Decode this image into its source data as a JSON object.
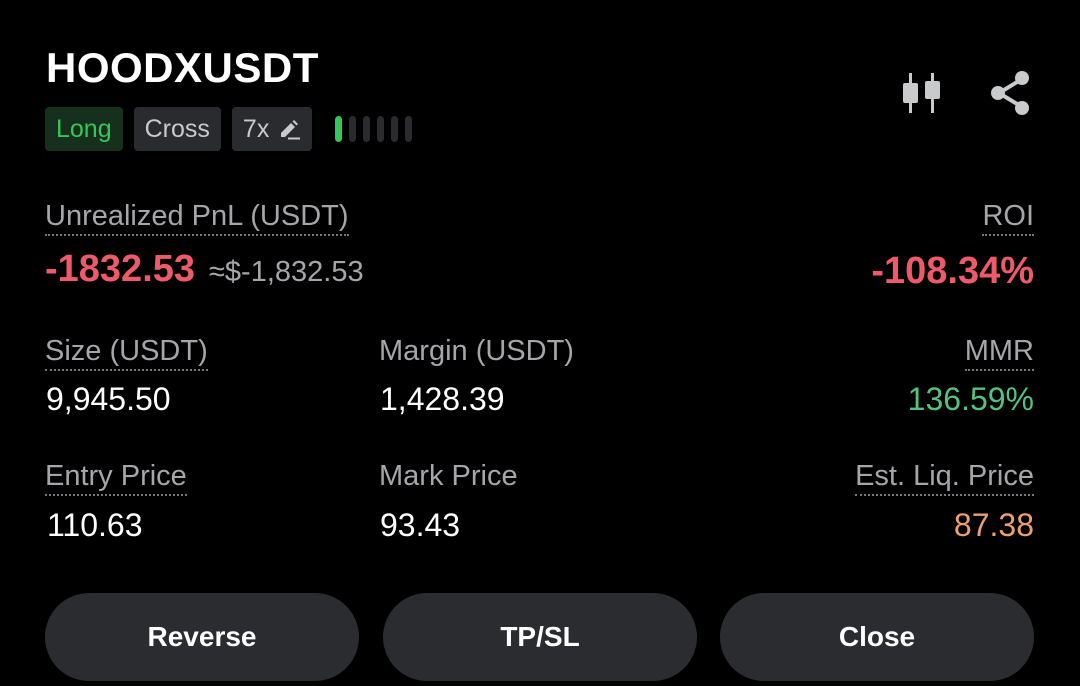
{
  "position": {
    "symbol": "HOODXUSDT",
    "side": "Long",
    "margin_mode": "Cross",
    "leverage": "7x",
    "risk_level": 1,
    "risk_level_max": 6
  },
  "icons": {
    "chart": "candlestick-chart-icon",
    "share": "share-icon",
    "edit": "pencil-edit-icon"
  },
  "pnl": {
    "label": "Unrealized PnL (USDT)",
    "value": "-1832.53",
    "approx": "≈$-1,832.53",
    "roi_label": "ROI",
    "roi_value": "-108.34%"
  },
  "stats": {
    "size_label": "Size (USDT)",
    "size_value": "9,945.50",
    "margin_label": "Margin (USDT)",
    "margin_value": "1,428.39",
    "mmr_label": "MMR",
    "mmr_value": "136.59%",
    "entry_label": "Entry Price",
    "entry_value": "110.63",
    "mark_label": "Mark Price",
    "mark_value": "93.43",
    "liq_label": "Est. Liq. Price",
    "liq_value": "87.38"
  },
  "actions": {
    "reverse": "Reverse",
    "tpsl": "TP/SL",
    "close": "Close"
  },
  "colors": {
    "negative": "#ee5a6a",
    "positive": "#53c27e",
    "liquidation": "#eca070",
    "long_tag": "#34c759",
    "background": "#000000"
  }
}
